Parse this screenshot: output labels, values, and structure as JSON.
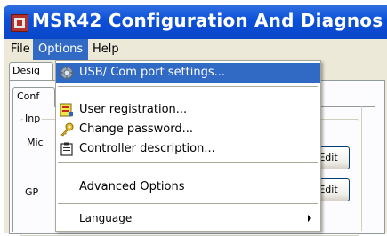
{
  "window": {
    "title": "MSR42 Configuration And Diagnos"
  },
  "menubar": {
    "items": [
      {
        "label": "File"
      },
      {
        "label": "Options"
      },
      {
        "label": "Help"
      }
    ]
  },
  "body": {
    "design_tab": "Desig",
    "conf_tab": "Conf",
    "group_label": "Inp",
    "row1_label": "Mic",
    "row2_label": "GP",
    "edit_label": "Edit"
  },
  "options_menu": {
    "items": [
      {
        "label": "USB/ Com port settings...",
        "icon": "gear-icon"
      },
      {
        "label": "User registration...",
        "icon": "user-registration-icon"
      },
      {
        "label": "Change password...",
        "icon": "key-icon"
      },
      {
        "label": "Controller description...",
        "icon": "clipboard-icon"
      },
      {
        "label": "Advanced Options"
      },
      {
        "label": "Language",
        "has_submenu": true
      }
    ]
  },
  "colors": {
    "titlebar": "#0b4fd8",
    "menu_highlight": "#316ac5",
    "window_bg": "#ece9d8"
  }
}
